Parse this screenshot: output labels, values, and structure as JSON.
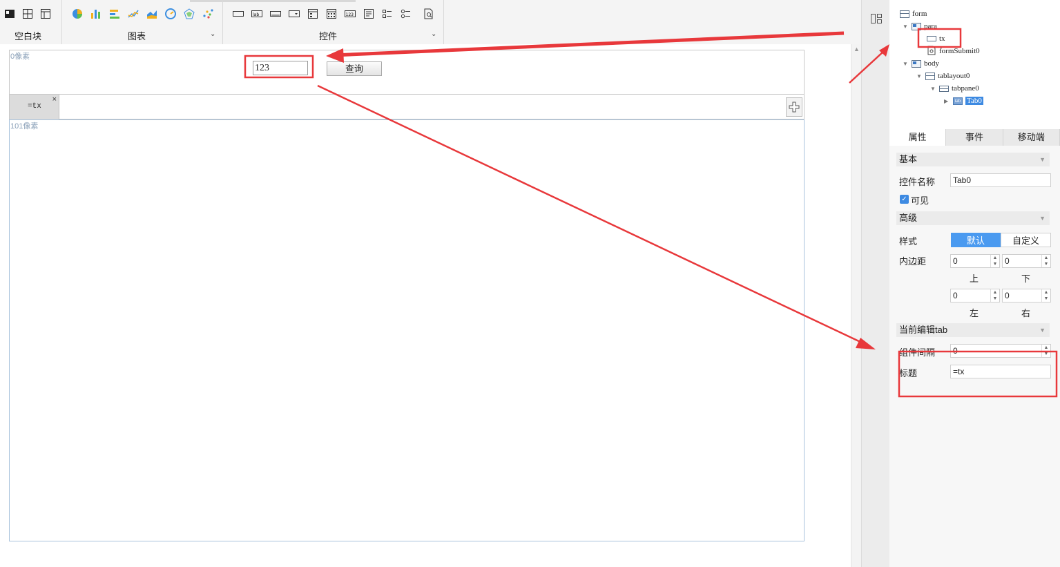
{
  "toolbar": {
    "blank_label": "空白块",
    "chart_label": "图表",
    "widget_label": "控件"
  },
  "canvas": {
    "para_px_label": "0像素",
    "tx_value": "123",
    "query_label": "查询",
    "tab_title": "=tx",
    "tab_close": "×",
    "body_px_label": "101像素"
  },
  "tree": {
    "nodes": [
      {
        "label": "form"
      },
      {
        "label": "para"
      },
      {
        "label": "tx"
      },
      {
        "label": "formSubmit0"
      },
      {
        "label": "body"
      },
      {
        "label": "tablayout0"
      },
      {
        "label": "tabpane0"
      },
      {
        "label": "Tab0"
      }
    ],
    "tab_icon_text": "tab"
  },
  "properties": {
    "tabs": [
      "属性",
      "事件",
      "移动端"
    ],
    "basic_section": "基本",
    "name_label": "控件名称",
    "name_value": "Tab0",
    "visible_label": "可见",
    "advanced_section": "高级",
    "style_label": "样式",
    "style_default": "默认",
    "style_custom": "自定义",
    "padding_label": "内边距",
    "padding": {
      "top": "0",
      "bottom": "0",
      "left": "0",
      "right": "0",
      "top_label": "上",
      "bottom_label": "下",
      "left_label": "左",
      "right_label": "右"
    },
    "current_tab_section": "当前编辑tab",
    "gap_label": "组件间隔",
    "gap_value": "0",
    "title_label": "标题",
    "title_value": "=tx"
  },
  "colors": {
    "accent": "#3d8ae2",
    "annotation_red": "#e8383b"
  }
}
